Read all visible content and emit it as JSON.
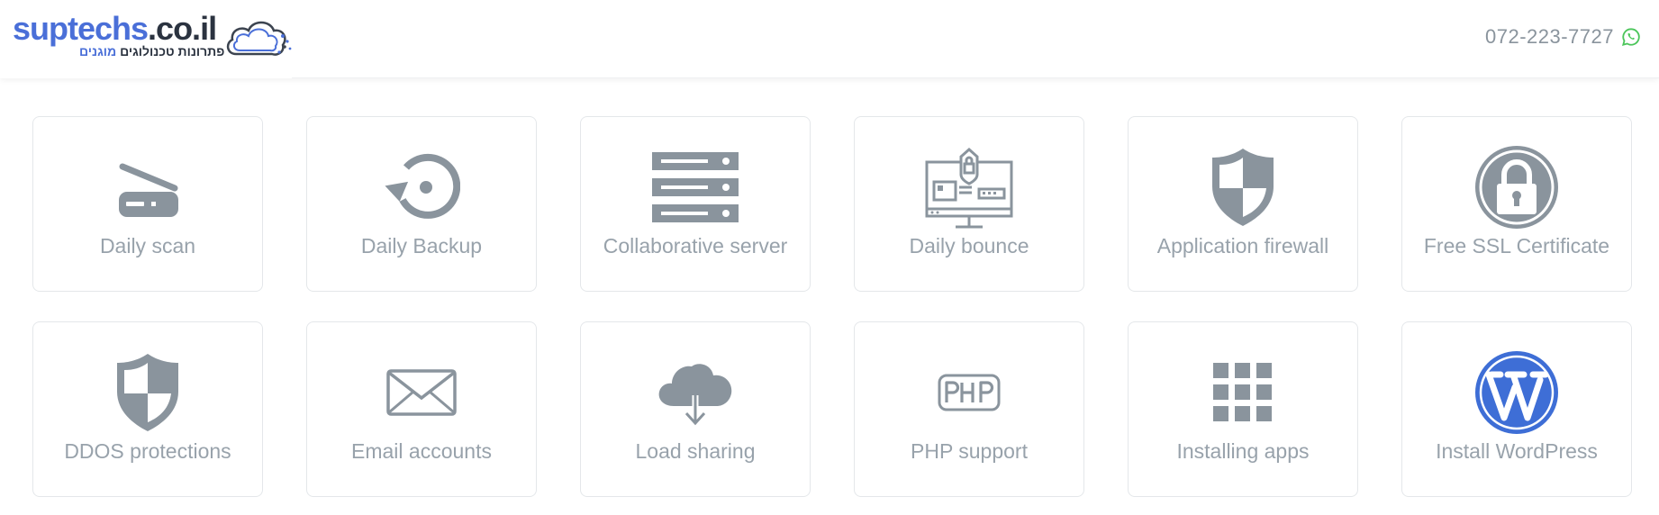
{
  "header": {
    "logo": {
      "brand": "suptechs",
      "domain": ".co.il",
      "tagline_main": "פתרונות טכנולוגים",
      "tagline_accent": "מוגנים"
    },
    "phone": "072-223-7727",
    "phone_icon": "whatsapp-icon"
  },
  "colors": {
    "icon_gray": "#8a949d",
    "brand_blue": "#4a6fd8",
    "whatsapp_green": "#4cc65b",
    "card_border": "#e4e7ea"
  },
  "services": [
    {
      "label": "Daily scan",
      "icon": "scanner-icon"
    },
    {
      "label": "Daily Backup",
      "icon": "backup-icon"
    },
    {
      "label": "Collaborative server",
      "icon": "server-icon"
    },
    {
      "label": "Daily bounce",
      "icon": "secure-monitor-icon"
    },
    {
      "label": "Application firewall",
      "icon": "shield-icon"
    },
    {
      "label": "Free SSL Certificate",
      "icon": "lock-icon"
    },
    {
      "label": "DDOS protections",
      "icon": "shield-icon"
    },
    {
      "label": "Email accounts",
      "icon": "envelope-icon"
    },
    {
      "label": "Load sharing",
      "icon": "cloud-download-icon"
    },
    {
      "label": "PHP support",
      "icon": "php-icon"
    },
    {
      "label": "Installing apps",
      "icon": "apps-grid-icon"
    },
    {
      "label": "Install WordPress",
      "icon": "wordpress-icon"
    }
  ]
}
